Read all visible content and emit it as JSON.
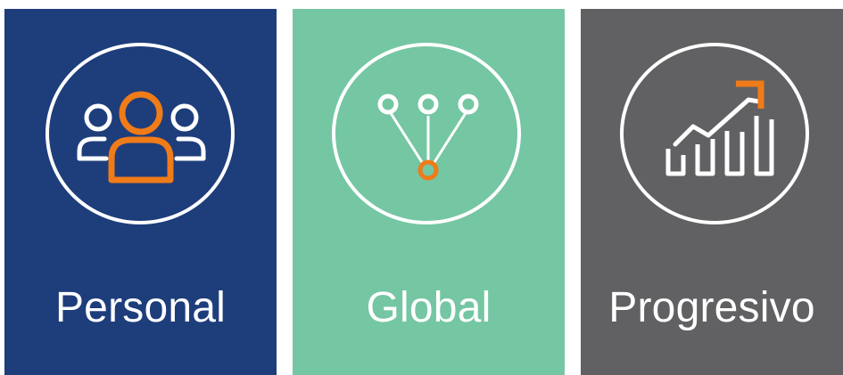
{
  "colors": {
    "personal_bg": "#1e3d7b",
    "global_bg": "#75c6a3",
    "progress_bg": "#616163",
    "accent": "#f07b19",
    "foreground": "#ffffff"
  },
  "cards": [
    {
      "label": "Personal",
      "icon": "people-group-icon"
    },
    {
      "label": "Global",
      "icon": "network-nodes-icon"
    },
    {
      "label": "Progresivo",
      "icon": "growth-chart-icon"
    }
  ]
}
